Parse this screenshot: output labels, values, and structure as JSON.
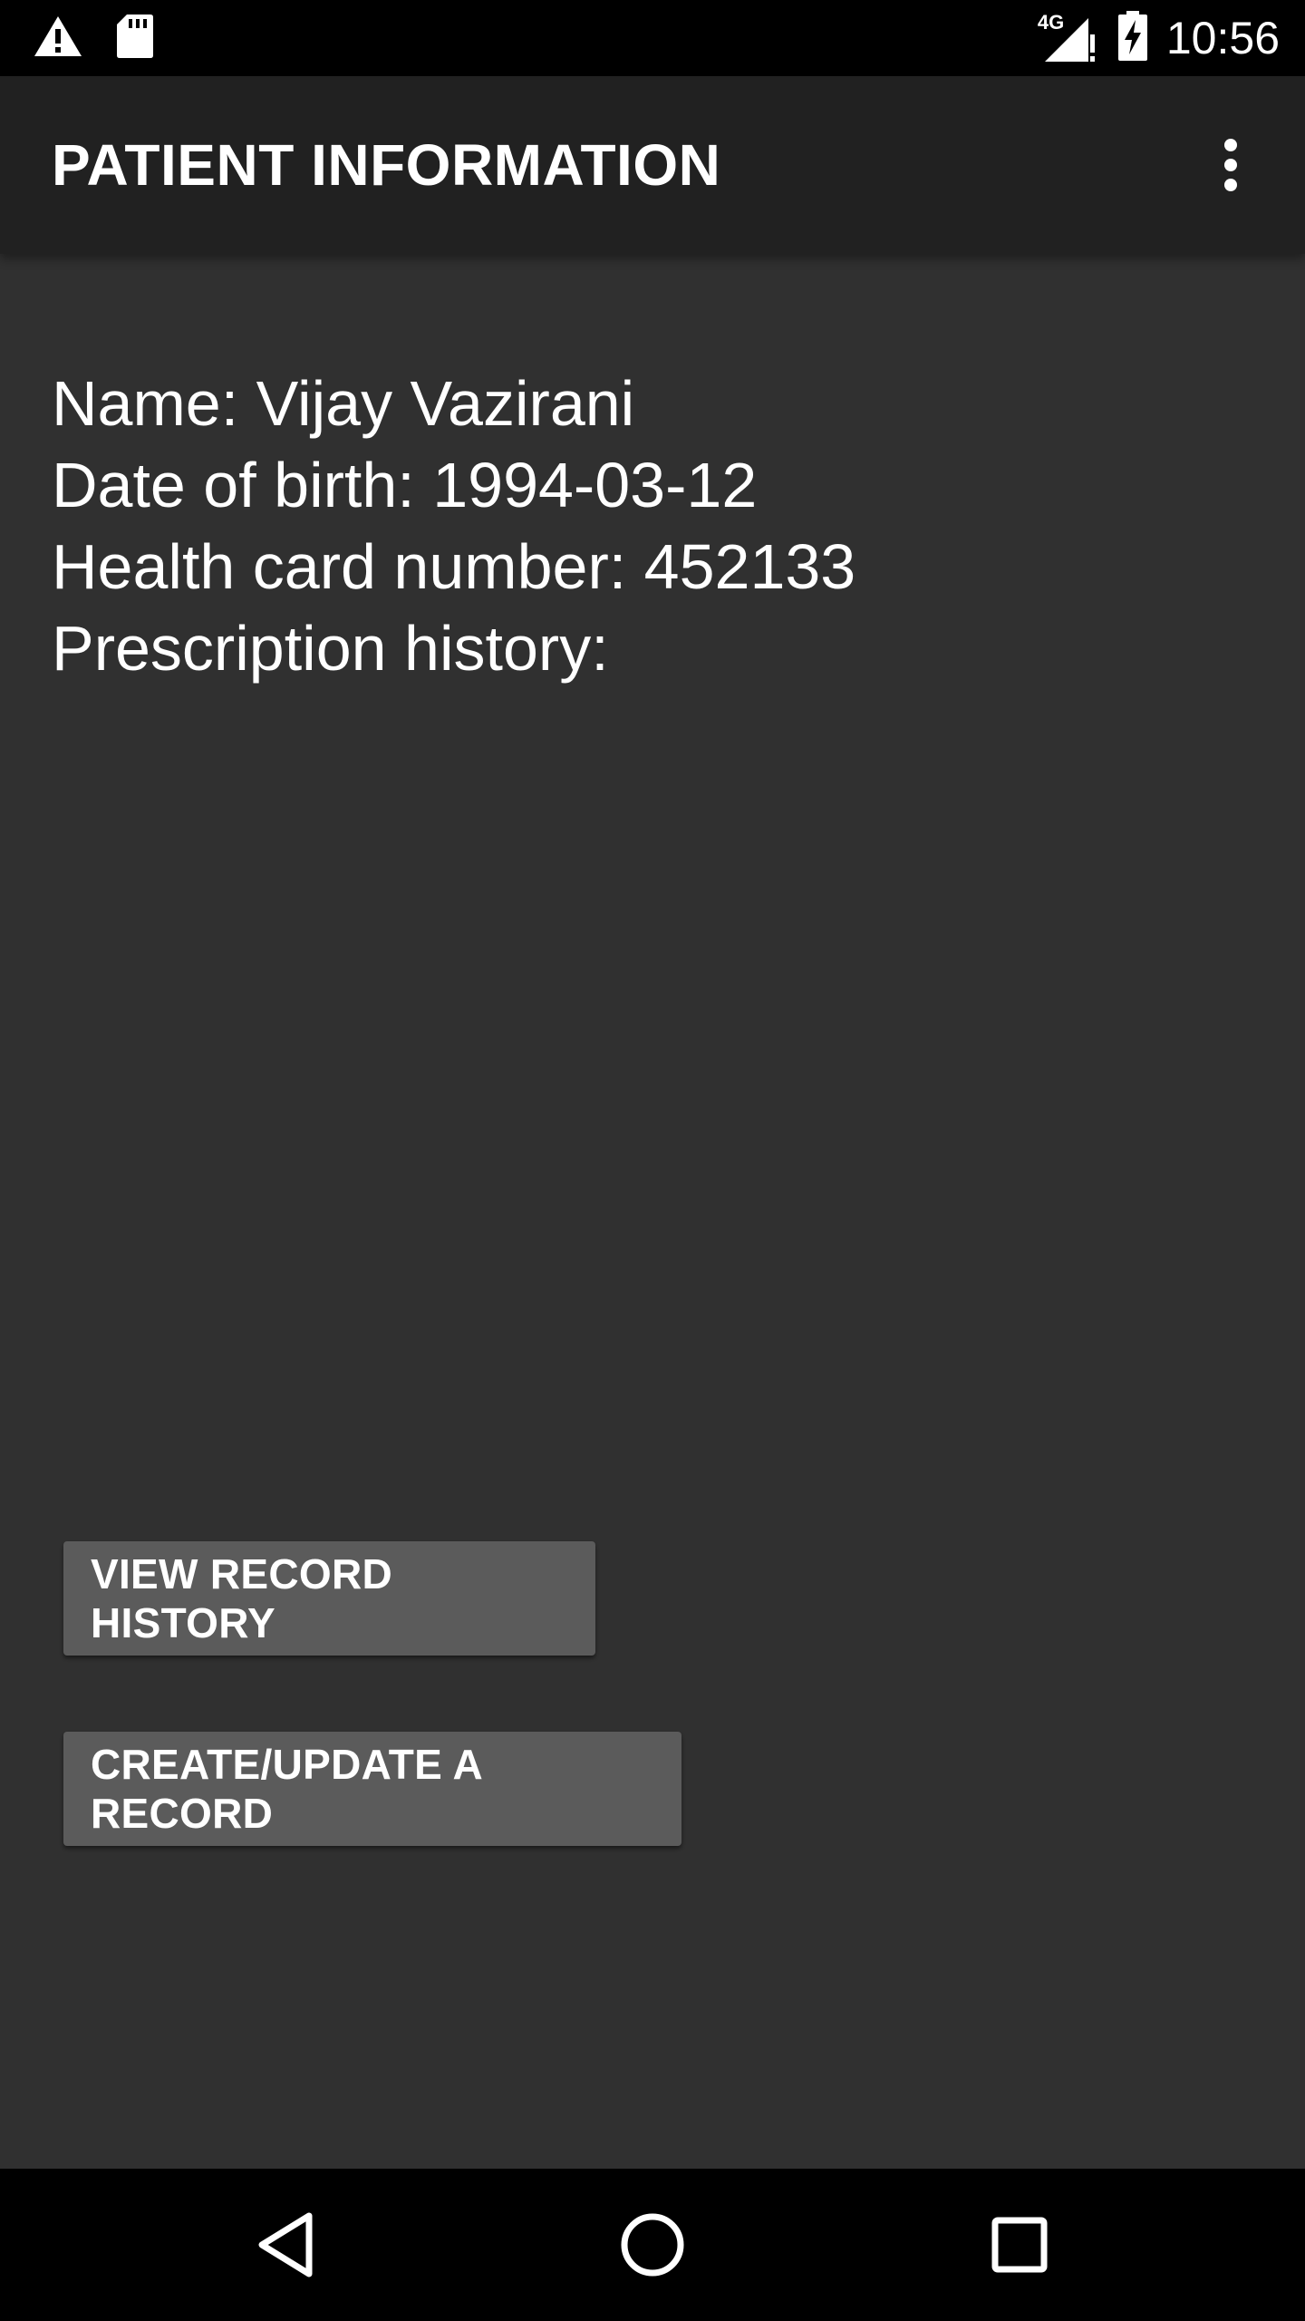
{
  "status_bar": {
    "left_icons": [
      "warning-icon",
      "sd-card-icon"
    ],
    "network_label": "4G",
    "right_icons": [
      "signal-icon",
      "battery-charging-icon"
    ],
    "time": "10:56"
  },
  "app_bar": {
    "title": "PATIENT INFORMATION",
    "overflow_icon": "more-vert-icon"
  },
  "patient": {
    "name_line": "Name: Vijay Vazirani",
    "dob_line": "Date of birth: 1994-03-12",
    "health_card_line": "Health card number: 452133",
    "prescription_line": "Prescription history:"
  },
  "actions": {
    "view_history_label": "VIEW RECORD HISTORY",
    "create_update_label": "CREATE/UPDATE A RECORD"
  },
  "nav_bar": {
    "back_icon": "back-triangle-icon",
    "home_icon": "home-circle-icon",
    "recents_icon": "recents-square-icon"
  },
  "colors": {
    "background": "#303030",
    "app_bar": "#212121",
    "button": "#5b5b5b",
    "text": "#ffffff"
  }
}
